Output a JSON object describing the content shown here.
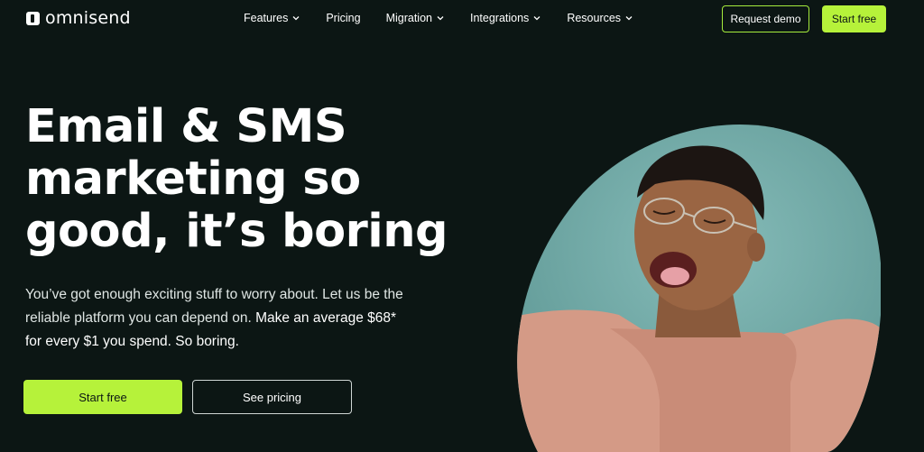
{
  "brand": {
    "name": "omnisend"
  },
  "nav": {
    "items": [
      {
        "label": "Features",
        "has_dropdown": true
      },
      {
        "label": "Pricing",
        "has_dropdown": false
      },
      {
        "label": "Migration",
        "has_dropdown": true
      },
      {
        "label": "Integrations",
        "has_dropdown": true
      },
      {
        "label": "Resources",
        "has_dropdown": true
      }
    ],
    "request_demo_label": "Request demo",
    "start_free_label": "Start free"
  },
  "hero": {
    "headline_line1": "Email & SMS",
    "headline_line2": "marketing so",
    "headline_line3": "good, it’s boring",
    "subtext_part1": "You’ve got enough exciting stuff to worry about. Let us be the reliable platform you can depend on. ",
    "subtext_part2": "Make an average $68* for every $1 you spend.",
    "subtext_part3": " So boring.",
    "primary_button": "Start free",
    "secondary_button": "See pricing"
  },
  "colors": {
    "background": "#0c1614",
    "accent": "#b6f23a",
    "image_bg": "#6fa8a6",
    "sweater": "#d49a86"
  },
  "icons": [
    "omnisend-logo-icon",
    "chevron-down-icon"
  ]
}
